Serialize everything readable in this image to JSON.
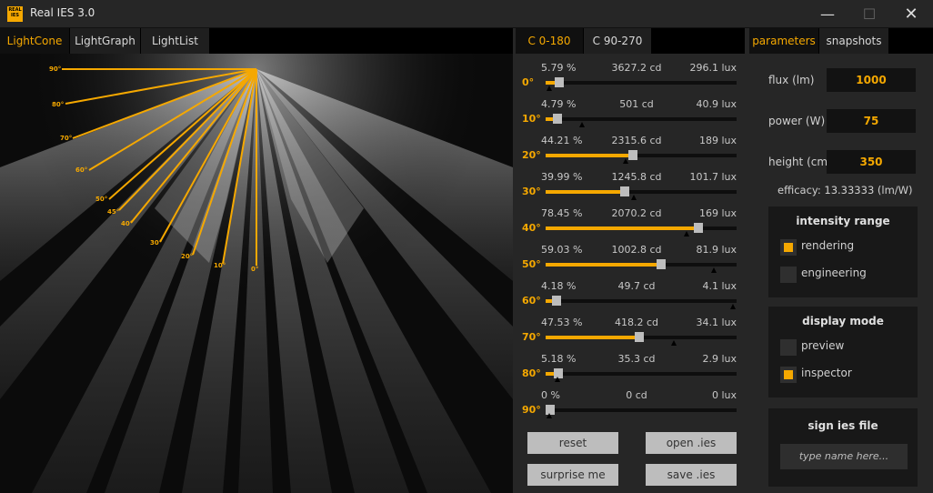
{
  "window": {
    "title": "Real IES 3.0",
    "icon_text_top": "REAL",
    "icon_text_bottom": "IES",
    "minimize": "—",
    "maximize": "☐",
    "close": "✕"
  },
  "left_tabs": [
    {
      "label": "LightCone",
      "active": true
    },
    {
      "label": "LightGraph",
      "active": false
    },
    {
      "label": "LightList",
      "active": false
    }
  ],
  "mid_tabs": [
    {
      "label": "C 0-180",
      "active": true
    },
    {
      "label": "C 90-270",
      "active": false
    }
  ],
  "right_tabs": [
    {
      "label": "parameters",
      "active": true
    },
    {
      "label": "snapshots",
      "active": false
    }
  ],
  "cone": {
    "angle_labels": [
      "90°",
      "80°",
      "70°",
      "60°",
      "50°",
      "45°",
      "40°",
      "30°",
      "20°",
      "10°",
      "0°"
    ]
  },
  "rows": [
    {
      "angle": "0°",
      "pct": "5.79 %",
      "cd": "3627.2 cd",
      "lux": "296.1 lux",
      "value": 0.0579,
      "marker": 0.02
    },
    {
      "angle": "10°",
      "pct": "4.79 %",
      "cd": "501 cd",
      "lux": "40.9 lux",
      "value": 0.0479,
      "marker": 0.19
    },
    {
      "angle": "20°",
      "pct": "44.21 %",
      "cd": "2315.6 cd",
      "lux": "189 lux",
      "value": 0.4421,
      "marker": 0.42
    },
    {
      "angle": "30°",
      "pct": "39.99 %",
      "cd": "1245.8 cd",
      "lux": "101.7 lux",
      "value": 0.3999,
      "marker": 0.46
    },
    {
      "angle": "40°",
      "pct": "78.45 %",
      "cd": "2070.2 cd",
      "lux": "169 lux",
      "value": 0.7845,
      "marker": 0.74
    },
    {
      "angle": "50°",
      "pct": "59.03 %",
      "cd": "1002.8 cd",
      "lux": "81.9 lux",
      "value": 0.5903,
      "marker": 0.88
    },
    {
      "angle": "60°",
      "pct": "4.18 %",
      "cd": "49.7 cd",
      "lux": "4.1 lux",
      "value": 0.0418,
      "marker": 0.98
    },
    {
      "angle": "70°",
      "pct": "47.53 %",
      "cd": "418.2 cd",
      "lux": "34.1 lux",
      "value": 0.4753,
      "marker": 0.67
    },
    {
      "angle": "80°",
      "pct": "5.18 %",
      "cd": "35.3 cd",
      "lux": "2.9 lux",
      "value": 0.0518,
      "marker": 0.06
    },
    {
      "angle": "90°",
      "pct": "0 %",
      "cd": "0 cd",
      "lux": "0 lux",
      "value": 0.0,
      "marker": 0.02
    }
  ],
  "buttons": {
    "reset": "reset",
    "open": "open .ies",
    "surprise": "surprise me",
    "save": "save .ies"
  },
  "params": {
    "flux_label": "flux (lm)",
    "flux_value": "1000",
    "power_label": "power (W)",
    "power_value": "75",
    "height_label": "height (cm)",
    "height_value": "350",
    "efficacy": "efficacy: 13.33333 (lm/W)"
  },
  "intensity_range": {
    "title": "intensity range",
    "options": [
      {
        "label": "rendering",
        "checked": true
      },
      {
        "label": "engineering",
        "checked": false
      }
    ]
  },
  "display_mode": {
    "title": "display mode",
    "options": [
      {
        "label": "preview",
        "checked": false
      },
      {
        "label": "inspector",
        "checked": true
      }
    ]
  },
  "sign": {
    "title": "sign ies file",
    "placeholder": "type name here..."
  },
  "colors": {
    "accent": "#f5a800",
    "panel": "#262626",
    "dark": "#0b0b0b"
  }
}
